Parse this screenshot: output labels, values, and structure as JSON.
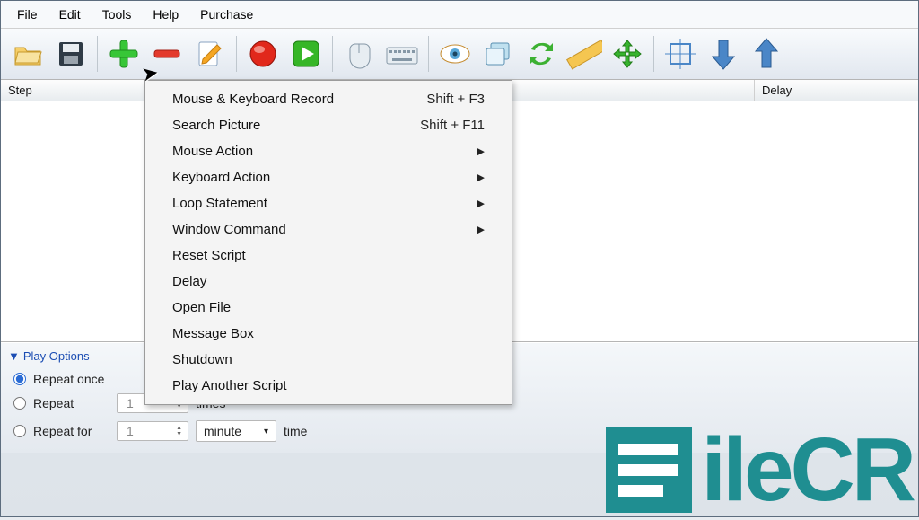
{
  "menubar": {
    "file": "File",
    "edit": "Edit",
    "tools": "Tools",
    "help": "Help",
    "purchase": "Purchase"
  },
  "toolbar_icons": {
    "open": "open-icon",
    "save": "save-icon",
    "add": "add-icon",
    "remove": "remove-icon",
    "edit": "edit-icon",
    "record": "record-icon",
    "play": "play-icon",
    "mouse": "mouse-icon",
    "keyboard": "keyboard-icon",
    "view": "view-icon",
    "windows": "windows-icon",
    "refresh": "refresh-icon",
    "ruler": "ruler-icon",
    "move": "move-icon",
    "bounds": "bounds-icon",
    "down": "down-arrow-icon",
    "up": "up-arrow-icon"
  },
  "columns": {
    "step": "Step",
    "delay": "Delay"
  },
  "dropdown": {
    "items": [
      {
        "label": "Mouse & Keyboard Record",
        "shortcut": "Shift + F3",
        "submenu": false
      },
      {
        "label": "Search Picture",
        "shortcut": "Shift + F11",
        "submenu": false
      },
      {
        "label": "Mouse Action",
        "shortcut": "",
        "submenu": true
      },
      {
        "label": "Keyboard Action",
        "shortcut": "",
        "submenu": true
      },
      {
        "label": "Loop Statement",
        "shortcut": "",
        "submenu": true
      },
      {
        "label": "Window Command",
        "shortcut": "",
        "submenu": true
      },
      {
        "label": "Reset Script",
        "shortcut": "",
        "submenu": false
      },
      {
        "label": "Delay",
        "shortcut": "",
        "submenu": false
      },
      {
        "label": "Open File",
        "shortcut": "",
        "submenu": false
      },
      {
        "label": "Message Box",
        "shortcut": "",
        "submenu": false
      },
      {
        "label": "Shutdown",
        "shortcut": "",
        "submenu": false
      },
      {
        "label": "Play Another Script",
        "shortcut": "",
        "submenu": false
      }
    ]
  },
  "play_options": {
    "title": "Play Options",
    "repeat_once": "Repeat once",
    "repeat": "Repeat",
    "repeat_for": "Repeat for",
    "times_value": "1",
    "times_label": "times",
    "for_value": "1",
    "unit": "minute",
    "time_label": "time"
  },
  "watermark": {
    "text": "ileCR"
  }
}
